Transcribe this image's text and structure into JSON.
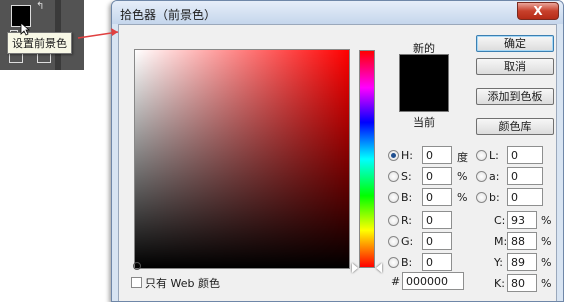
{
  "toolbar": {
    "tooltip": "设置前景色"
  },
  "dialog": {
    "title": "拾色器（前景色）",
    "close_label": "X",
    "new_label": "新的",
    "current_label": "当前",
    "buttons": {
      "ok": "确定",
      "cancel": "取消",
      "add_swatch": "添加到色板",
      "libraries": "颜色库"
    },
    "hsb": [
      {
        "label": "H:",
        "value": "0",
        "unit": "度",
        "checked": true
      },
      {
        "label": "S:",
        "value": "0",
        "unit": "%",
        "checked": false
      },
      {
        "label": "B:",
        "value": "0",
        "unit": "%",
        "checked": false
      }
    ],
    "rgb": [
      {
        "label": "R:",
        "value": "0"
      },
      {
        "label": "G:",
        "value": "0"
      },
      {
        "label": "B:",
        "value": "0"
      }
    ],
    "lab": [
      {
        "label": "L:",
        "value": "0"
      },
      {
        "label": "a:",
        "value": "0"
      },
      {
        "label": "b:",
        "value": "0"
      }
    ],
    "cmyk": [
      {
        "label": "C:",
        "value": "93",
        "unit": "%"
      },
      {
        "label": "M:",
        "value": "88",
        "unit": "%"
      },
      {
        "label": "Y:",
        "value": "89",
        "unit": "%"
      },
      {
        "label": "K:",
        "value": "80",
        "unit": "%"
      }
    ],
    "hex_label": "#",
    "hex_value": "000000",
    "web_only_label": "只有 Web 颜色"
  },
  "colors": {
    "foreground": "#000000",
    "hue": "#ff0000",
    "accent": "#e04040"
  }
}
